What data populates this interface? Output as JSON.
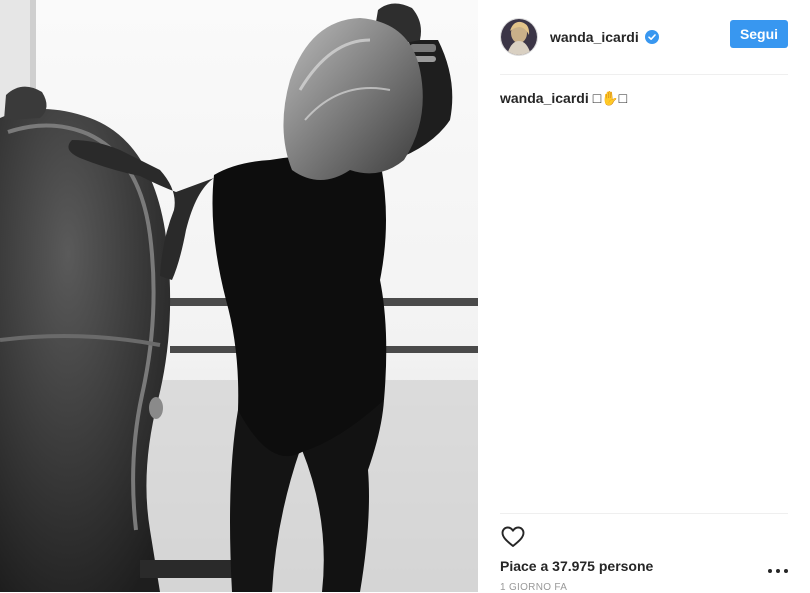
{
  "post": {
    "image_alt": "",
    "author": {
      "username": "wanda_icardi",
      "verified": true,
      "verified_icon": "verified-badge-icon"
    },
    "follow_label": "Segui",
    "caption": {
      "username": "wanda_icardi",
      "text": "□✋□"
    },
    "actions": {
      "like_icon": "heart-outline-icon",
      "more_icon": "more-options-icon"
    },
    "likes_text": "Piace a 37.975 persone",
    "timestamp": "1 GIORNO FA"
  },
  "colors": {
    "accent": "#3897f0",
    "text": "#262626",
    "muted": "#999999",
    "divider": "#efefef"
  }
}
